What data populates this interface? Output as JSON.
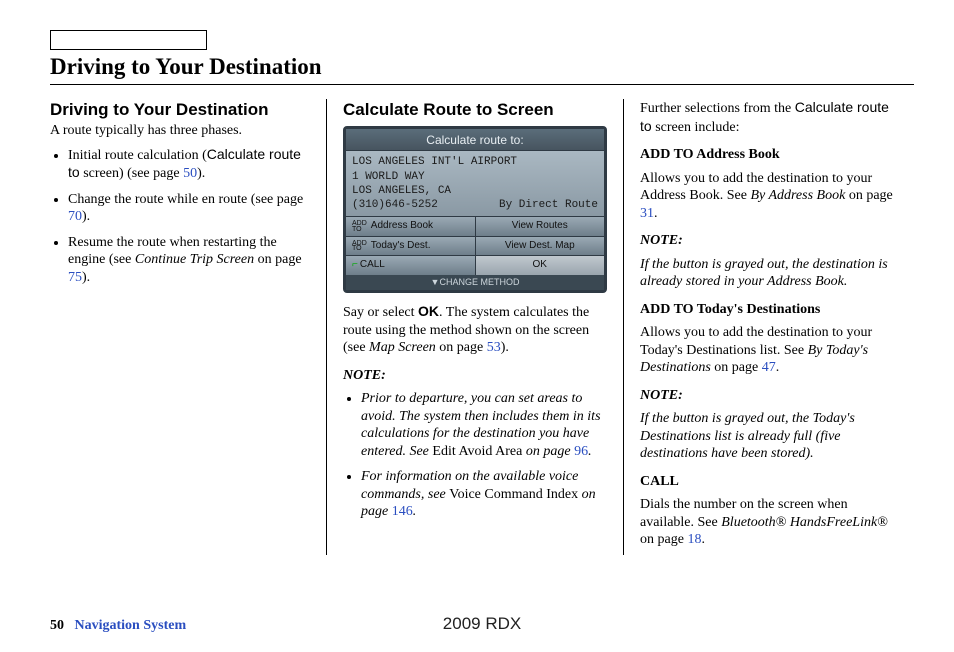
{
  "chapterTitle": "Driving to Your Destination",
  "col1": {
    "heading": "Driving to Your Destination",
    "intro": "A route typically has three phases.",
    "b1_a": "Initial route calculation (",
    "b1_b": "Calculate route to",
    "b1_c": " screen) (see page ",
    "b1_pg": "50",
    "b1_d": ").",
    "b2_a": "Change the route while en route (see page ",
    "b2_pg": "70",
    "b2_b": ").",
    "b3_a": "Resume the route when restarting the engine (see ",
    "b3_i": "Continue Trip Screen",
    "b3_b": " on page ",
    "b3_pg": "75",
    "b3_c": ")."
  },
  "col2": {
    "heading": "Calculate Route to Screen",
    "screen": {
      "title": "Calculate route to:",
      "line1": "LOS ANGELES INT'L AIRPORT",
      "line2": "1 WORLD WAY",
      "line3": "LOS ANGELES, CA",
      "phone": "(310)646-5252",
      "route": "By Direct Route",
      "addTo1": "Address Book",
      "right1": "View Routes",
      "addTo2": "Today's Dest.",
      "right2": "View Dest. Map",
      "call": "CALL",
      "ok": "OK",
      "footer": "▼CHANGE METHOD"
    },
    "p1_a": "Say or select ",
    "p1_b": "OK",
    "p1_c": ". The system calculates the route using the method shown on the screen (see ",
    "p1_i": "Map Screen",
    "p1_d": " on page ",
    "p1_pg": "53",
    "p1_e": ").",
    "noteLabel": "NOTE:",
    "n1_a": "Prior to departure, you can set areas to avoid. The system then includes them in its calculations for the destination you have entered. See ",
    "n1_r": "Edit Avoid Area",
    "n1_b": " on page ",
    "n1_pg": "96",
    "n1_c": ".",
    "n2_a": "For information on the available voice commands, see ",
    "n2_r": "Voice Command Index",
    "n2_b": " on page ",
    "n2_pg": "146",
    "n2_c": "."
  },
  "col3": {
    "intro_a": "Further selections from the ",
    "intro_b": "Calculate route to",
    "intro_c": " screen include:",
    "s1_head": "ADD TO Address Book",
    "s1_a": "Allows you to add the destination to your Address Book. See ",
    "s1_i": "By Address Book",
    "s1_b": " on page ",
    "s1_pg": "31",
    "s1_c": ".",
    "noteLabel": "NOTE:",
    "n1": "If the button is grayed out, the destination is already stored in your Address Book.",
    "s2_head": "ADD TO Today's Destinations",
    "s2_a": "Allows you to add the destination to your Today's Destinations list. See ",
    "s2_i": "By Today's Destinations",
    "s2_b": " on page ",
    "s2_pg": "47",
    "s2_c": ".",
    "n2": "If the button is grayed out, the Today's Destinations list is already full (five destinations have been stored).",
    "s3_head": "CALL",
    "s3_a": "Dials the number on the screen when available. See ",
    "s3_i": "Bluetooth® HandsFreeLink®",
    "s3_b": " on page ",
    "s3_pg": "18",
    "s3_c": "."
  },
  "footer": {
    "pageNum": "50",
    "section": "Navigation System",
    "model": "2009 RDX"
  }
}
